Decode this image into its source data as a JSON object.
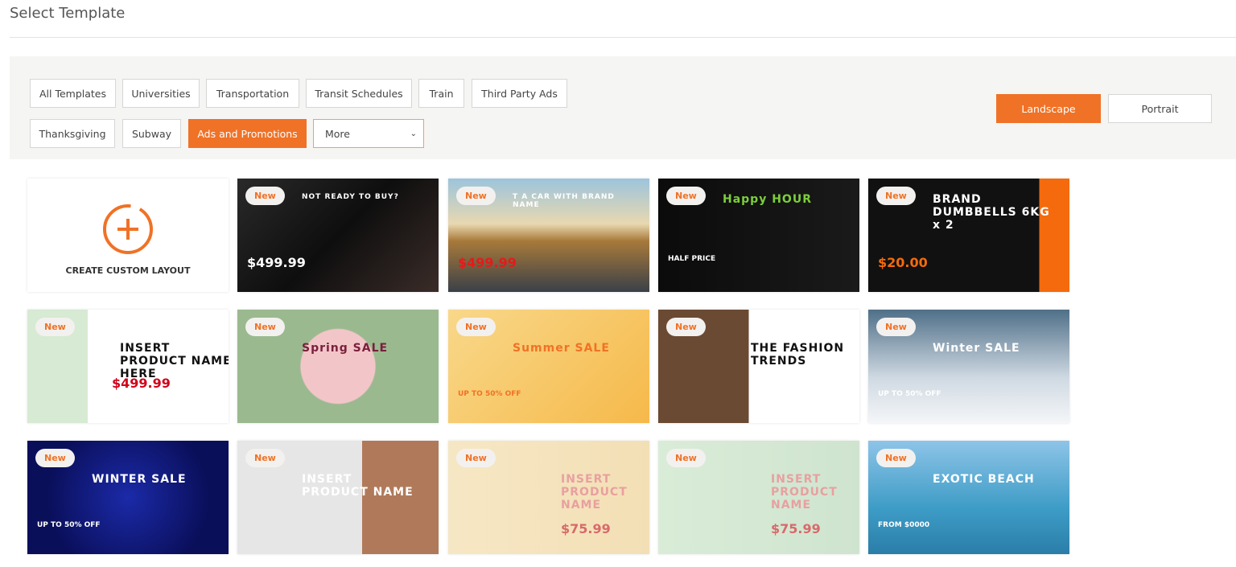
{
  "header": {
    "title": "Select Template"
  },
  "filters": {
    "row1": [
      "All Templates",
      "Universities",
      "Transportation",
      "Transit Schedules",
      "Train",
      "Third Party Ads"
    ],
    "row2": [
      "Thanksgiving",
      "Subway",
      "Ads and Promotions"
    ],
    "more": "More",
    "active": "Ads and Promotions"
  },
  "orientation": {
    "landscape": "Landscape",
    "portrait": "Portrait",
    "active": "Landscape"
  },
  "accent": "#f07226",
  "create": {
    "label": "CREATE CUSTOM LAYOUT",
    "icon": "plus-circle-icon"
  },
  "badge": "New",
  "templates": [
    {
      "headline": "NOT READY TO BUY?",
      "price": "$499.99"
    },
    {
      "headline": "T A CAR WITH BRAND NAME",
      "price": "$499.99"
    },
    {
      "headline": "Happy HOUR",
      "price": "HALF PRICE"
    },
    {
      "headline": "BRAND DUMBBELLS 6KG x 2",
      "price": "$20.00"
    },
    {
      "headline": "INSERT PRODUCT NAME HERE",
      "price": "$499.99"
    },
    {
      "headline": "Spring SALE",
      "price": ""
    },
    {
      "headline": "Summer SALE",
      "price": "UP TO 50% OFF"
    },
    {
      "headline": "THE FASHION TRENDS",
      "price": ""
    },
    {
      "headline": "Winter SALE",
      "price": "UP TO 50% OFF"
    },
    {
      "headline": "WINTER SALE",
      "price": "UP TO 50% OFF"
    },
    {
      "headline": "INSERT PRODUCT NAME",
      "price": ""
    },
    {
      "headline": "INSERT PRODUCT NAME",
      "price": "$75.99"
    },
    {
      "headline": "INSERT PRODUCT NAME",
      "price": "$75.99"
    },
    {
      "headline": "EXOTIC BEACH",
      "price": "FROM $0000"
    }
  ]
}
